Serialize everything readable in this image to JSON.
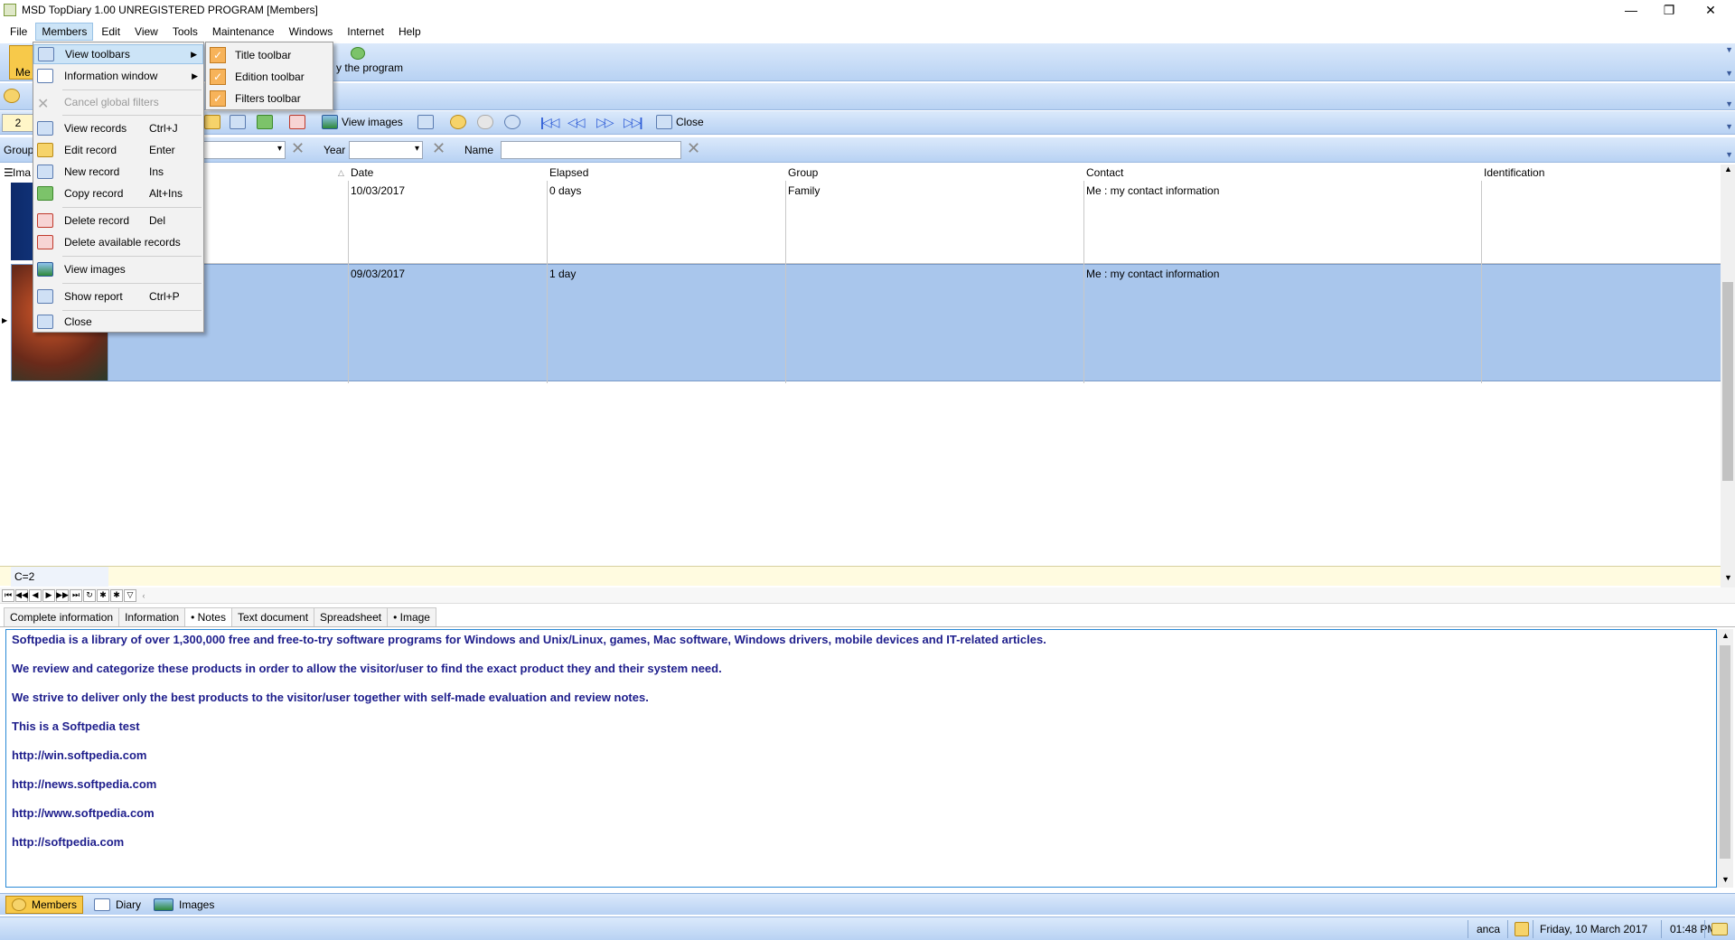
{
  "window": {
    "title": "MSD TopDiary 1.00 UNREGISTERED PROGRAM [Members]",
    "minimize": "—",
    "restore": "❐",
    "close": "✕"
  },
  "menubar": [
    "File",
    "Members",
    "Edit",
    "View",
    "Tools",
    "Maintenance",
    "Windows",
    "Internet",
    "Help"
  ],
  "toolbar_title": {
    "item_label_partial": "Me",
    "about_label": "y the program"
  },
  "toolbar_edit": {
    "record_number": "2",
    "view_images": "View images",
    "close": "Close"
  },
  "filters": {
    "group_label": "Group",
    "year_label": "Year",
    "name_label": "Name",
    "name_value": "",
    "year_value": ""
  },
  "grid": {
    "columns": [
      "Ima",
      "Date",
      "Elapsed",
      "Group",
      "Contact",
      "Identification"
    ],
    "rows": [
      {
        "date": "10/03/2017",
        "elapsed": "0 days",
        "group": "Family",
        "contact": "Me : my contact information",
        "identification": ""
      },
      {
        "date": "09/03/2017",
        "elapsed": "1 day",
        "group": "",
        "contact": "Me : my contact information",
        "identification": ""
      }
    ],
    "count": "C=2"
  },
  "tabs": [
    "Complete information",
    "Information",
    "• Notes",
    "Text document",
    "Spreadsheet",
    "• Image"
  ],
  "notes": [
    "Softpedia is a library of over 1,300,000 free and free-to-try software programs for Windows and Unix/Linux, games, Mac software, Windows drivers, mobile devices and IT-related articles.",
    "We review and categorize these products in order to allow the visitor/user to find the exact product they and their system need.",
    "We strive to deliver only the best products to the visitor/user together with self-made evaluation and review notes.",
    "This is a  Softpedia test",
    "http://win.softpedia.com",
    "http://news.softpedia.com",
    "http://www.softpedia.com",
    "http://softpedia.com"
  ],
  "modules": [
    "Members",
    "Diary",
    "Images"
  ],
  "status": {
    "user": "anca",
    "date": "Friday, 10 March 2017",
    "time": "01:48 PM"
  },
  "members_menu": [
    {
      "label": "View toolbars",
      "shortcut": "",
      "submenu": true,
      "highlighted": true,
      "disabled": false
    },
    {
      "label": "Information window",
      "shortcut": "",
      "submenu": true,
      "highlighted": false,
      "disabled": false
    },
    {
      "label": "Cancel global filters",
      "shortcut": "",
      "submenu": false,
      "highlighted": false,
      "disabled": true
    },
    {
      "label": "View records",
      "shortcut": "Ctrl+J",
      "submenu": false,
      "highlighted": false,
      "disabled": false
    },
    {
      "label": "Edit record",
      "shortcut": "Enter",
      "submenu": false,
      "highlighted": false,
      "disabled": false
    },
    {
      "label": "New record",
      "shortcut": "Ins",
      "submenu": false,
      "highlighted": false,
      "disabled": false
    },
    {
      "label": "Copy record",
      "shortcut": "Alt+Ins",
      "submenu": false,
      "highlighted": false,
      "disabled": false
    },
    {
      "label": "Delete record",
      "shortcut": "Del",
      "submenu": false,
      "highlighted": false,
      "disabled": false
    },
    {
      "label": "Delete available records",
      "shortcut": "",
      "submenu": false,
      "highlighted": false,
      "disabled": false
    },
    {
      "label": "View images",
      "shortcut": "",
      "submenu": false,
      "highlighted": false,
      "disabled": false
    },
    {
      "label": "Show report",
      "shortcut": "Ctrl+P",
      "submenu": false,
      "highlighted": false,
      "disabled": false
    },
    {
      "label": "Close",
      "shortcut": "",
      "submenu": false,
      "highlighted": false,
      "disabled": false
    }
  ],
  "toolbars_submenu": [
    {
      "label": "Title toolbar",
      "checked": true
    },
    {
      "label": "Edition toolbar",
      "checked": true
    },
    {
      "label": "Filters toolbar",
      "checked": true
    }
  ],
  "colors": {
    "accent": "#b8d2f3",
    "selection": "#a9c6ec",
    "notes_text": "#1e1e8c",
    "active_module": "#f7c94a"
  }
}
